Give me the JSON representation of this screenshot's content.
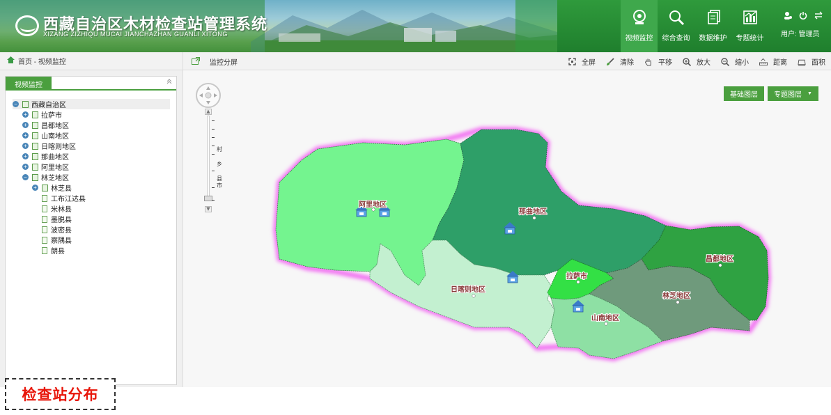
{
  "header": {
    "title": "西藏自治区木材检查站管理系统",
    "subtitle": "XIZANG ZIZHIQU MUCAI JIANCHAZHAN GUANLI XITONG",
    "nav": [
      {
        "label": "视频监控",
        "icon": "camera-icon",
        "active": true
      },
      {
        "label": "综合查询",
        "icon": "search-icon",
        "active": false
      },
      {
        "label": "数据维护",
        "icon": "documents-icon",
        "active": false
      },
      {
        "label": "专题统计",
        "icon": "chart-icon",
        "active": false
      }
    ],
    "user_label": "用户: 管理员"
  },
  "breadcrumb": "首页 - 视频监控",
  "toolbar": {
    "split_label": "监控分屏",
    "tools": [
      {
        "label": "全屏",
        "icon": "fullscreen-icon"
      },
      {
        "label": "清除",
        "icon": "brush-icon"
      },
      {
        "label": "平移",
        "icon": "hand-icon"
      },
      {
        "label": "放大",
        "icon": "zoom-in-icon"
      },
      {
        "label": "缩小",
        "icon": "zoom-out-icon"
      },
      {
        "label": "距离",
        "icon": "ruler-icon"
      },
      {
        "label": "面积",
        "icon": "area-icon"
      }
    ]
  },
  "panel": {
    "tab_label": "视频监控",
    "tree": [
      {
        "label": "西藏自治区",
        "level": 0,
        "toggle": "-",
        "type": "folder",
        "selected": true
      },
      {
        "label": "拉萨市",
        "level": 1,
        "toggle": "+",
        "type": "folder"
      },
      {
        "label": "昌都地区",
        "level": 1,
        "toggle": "+",
        "type": "folder"
      },
      {
        "label": "山南地区",
        "level": 1,
        "toggle": "+",
        "type": "folder"
      },
      {
        "label": "日喀则地区",
        "level": 1,
        "toggle": "+",
        "type": "folder"
      },
      {
        "label": "那曲地区",
        "level": 1,
        "toggle": "+",
        "type": "folder"
      },
      {
        "label": "阿里地区",
        "level": 1,
        "toggle": "+",
        "type": "folder"
      },
      {
        "label": "林芝地区",
        "level": 1,
        "toggle": "-",
        "type": "folder"
      },
      {
        "label": "林芝县",
        "level": 2,
        "toggle": "+",
        "type": "folder"
      },
      {
        "label": "工布江达县",
        "level": 2,
        "toggle": "",
        "type": "doc"
      },
      {
        "label": "米林县",
        "level": 2,
        "toggle": "",
        "type": "doc"
      },
      {
        "label": "墨脱县",
        "level": 2,
        "toggle": "",
        "type": "doc"
      },
      {
        "label": "波密县",
        "level": 2,
        "toggle": "",
        "type": "doc"
      },
      {
        "label": "察隅县",
        "level": 2,
        "toggle": "",
        "type": "doc"
      },
      {
        "label": "朗县",
        "level": 2,
        "toggle": "",
        "type": "doc"
      }
    ]
  },
  "map": {
    "zoom_labels": [
      "村",
      "乡",
      "县",
      "市"
    ],
    "layer_buttons": [
      "基础图层",
      "专题图层"
    ],
    "regions": [
      {
        "name": "阿里地区",
        "color": "#74f48f"
      },
      {
        "name": "那曲地区",
        "color": "#2e9f68"
      },
      {
        "name": "昌都地区",
        "color": "#2fa242"
      },
      {
        "name": "日喀则地区",
        "color": "#c3f0d0"
      },
      {
        "name": "拉萨市",
        "color": "#33e045"
      },
      {
        "name": "林芝地区",
        "color": "#6f9a7c"
      },
      {
        "name": "山南地区",
        "color": "#8ee0a4"
      }
    ],
    "border_glow": "#f26af2"
  },
  "caption": "检查站分布"
}
